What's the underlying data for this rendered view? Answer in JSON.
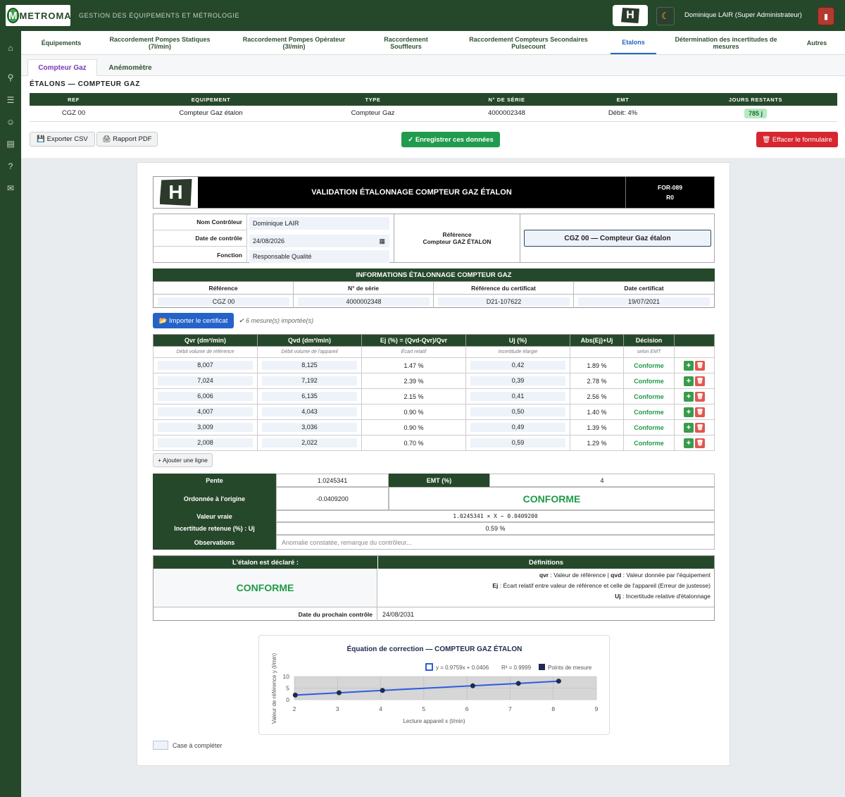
{
  "topbar": {
    "logo_letter": "M",
    "logo_word": "METROMAT",
    "subtitle": "GESTION DES ÉQUIPEMENTS ET MÉTROLOGIE",
    "user": "Dominique LAIR (Super Administrateur)",
    "logo_h": "H",
    "theme_icon": "moon-icon",
    "logout_icon": "logout-icon"
  },
  "sidebar": {
    "icons": [
      "home-icon",
      "search-icon",
      "sliders-icon",
      "user-icon",
      "document-icon",
      "help-icon",
      "mail-icon"
    ]
  },
  "nav": {
    "tabs": [
      {
        "label": "Équipements"
      },
      {
        "label": "Raccordement Pompes Statiques (7l/min)"
      },
      {
        "label": "Raccordement Pompes Opérateur (3l/min)"
      },
      {
        "label": "Raccordement Souffleurs"
      },
      {
        "label": "Raccordement Compteurs Secondaires Pulsecount"
      },
      {
        "label": "Etalons"
      },
      {
        "label": "Détermination des incertitudes de mesures"
      },
      {
        "label": "Autres"
      }
    ],
    "active": "Etalons"
  },
  "subtabs": [
    {
      "label": "Compteur Gaz"
    },
    {
      "label": "Anémomètre"
    }
  ],
  "etalons": {
    "title": "ÉTALONS — COMPTEUR GAZ",
    "headers": [
      "REF",
      "EQUIPEMENT",
      "TYPE",
      "N° DE SÉRIE",
      "EMT",
      "JOURS RESTANTS"
    ],
    "row": {
      "ref": "CGZ 00",
      "equipement": "Compteur Gaz étalon",
      "type": "Compteur Gaz",
      "serie": "4000002348",
      "emt": "Débit: 4%",
      "jours": "785 j"
    }
  },
  "actions": {
    "csv": "💾 Exporter CSV",
    "pdf": "🖨 Rapport PDF",
    "save": "✓ Enregistrer ces données",
    "clear": "🗑 Effacer le formulaire"
  },
  "form": {
    "header": {
      "logo": "H",
      "title": "VALIDATION ÉTALONNAGE COMPTEUR GAZ ÉTALON",
      "code": "FOR-089",
      "rev": "R0"
    },
    "controller": {
      "name_label": "Nom Contrôleur",
      "name": "Dominique LAIR",
      "date_label": "Date de contrôle",
      "date": "24/08/2026",
      "fn_label": "Fonction",
      "fn": "Responsable Qualité",
      "ref_label_1": "Référence",
      "ref_label_2": "Compteur GAZ ÉTALON",
      "ref_value": "CGZ 00 — Compteur Gaz étalon"
    },
    "info": {
      "title": "INFORMATIONS ÉTALONNAGE COMPTEUR GAZ",
      "headers": [
        "Référence",
        "N° de série",
        "Référence du certificat",
        "Date certificat"
      ],
      "values": [
        "CGZ 00",
        "4000002348",
        "D21-107622",
        "19/07/2021"
      ]
    },
    "import": {
      "button": "📂 Importer le certificat",
      "status": "✔ 6 mesure(s) importée(s)"
    },
    "measures": {
      "headers": [
        "Qvr (dm³/min)",
        "Qvd (dm³/min)",
        "Ej (%) = (Qvd-Qvr)/Qvr",
        "Uj (%)",
        "Abs(Ej)+Uj",
        "Décision"
      ],
      "subheaders": [
        "Débit volume de référence",
        "Débit volume de l'appareil",
        "Écart relatif",
        "Incertitude élargie",
        "",
        "selon EMT"
      ],
      "rows": [
        {
          "qvr": "8,007",
          "qvd": "8,125",
          "ej": "1.47 %",
          "uj": "0,42",
          "abs": "1.89 %",
          "dec": "Conforme"
        },
        {
          "qvr": "7,024",
          "qvd": "7,192",
          "ej": "2.39 %",
          "uj": "0,39",
          "abs": "2.78 %",
          "dec": "Conforme"
        },
        {
          "qvr": "6,006",
          "qvd": "6,135",
          "ej": "2.15 %",
          "uj": "0,41",
          "abs": "2.56 %",
          "dec": "Conforme"
        },
        {
          "qvr": "4,007",
          "qvd": "4,043",
          "ej": "0.90 %",
          "uj": "0,50",
          "abs": "1.40 %",
          "dec": "Conforme"
        },
        {
          "qvr": "3,009",
          "qvd": "3,036",
          "ej": "0.90 %",
          "uj": "0,49",
          "abs": "1.39 %",
          "dec": "Conforme"
        },
        {
          "qvr": "2,008",
          "qvd": "2,022",
          "ej": "0.70 %",
          "uj": "0,59",
          "abs": "1.29 %",
          "dec": "Conforme"
        }
      ],
      "add_row": "+ Ajouter une ligne",
      "plus": "+",
      "del": "🗑"
    },
    "calc": {
      "pente_l": "Pente",
      "pente": "1.0245341",
      "emt_l": "EMT (%)",
      "emt": "4",
      "ord_l": "Ordonnée à l'origine",
      "ord": "-0.0409200",
      "verdict": "CONFORME",
      "vv_l": "Valeur vraie",
      "vv": "1.0245341 × X − 0.0409200",
      "inc_l": "Incertitude retenue (%) : Uj",
      "inc": "0.59 %",
      "obs_l": "Observations",
      "obs_ph": "Anomalie constatée, remarque du contrôleur..."
    },
    "decl": {
      "title": "L'étalon est déclaré :",
      "verdict": "CONFORME",
      "def_title": "Définitions",
      "d1a": "qvr",
      "d1b": " : Valeur de référence  |  ",
      "d1c": "qvd",
      "d1d": " : Valeur donnée par l'équipement",
      "d2a": "Ej",
      "d2b": " : Écart relatif entre valeur de référence et celle de l'appareil (Erreur de justesse)",
      "d3a": "Uj",
      "d3b": " : Incertitude relative d'étalonnage",
      "next_l": "Date du prochain contrôle",
      "next": "24/08/2031"
    },
    "legend_text": "Case à compléter"
  },
  "chart_data": {
    "type": "line",
    "title": "Équation de correction — COMPTEUR GAZ ÉTALON",
    "xlabel": "Lecture appareil x (l/min)",
    "ylabel": "Valeur de référence y (l/min)",
    "xlim": [
      2,
      9
    ],
    "ylim": [
      0,
      10
    ],
    "xticks": [
      2,
      3,
      4,
      5,
      6,
      7,
      8,
      9
    ],
    "yticks": [
      0,
      5,
      10
    ],
    "series": [
      {
        "name": "y = 0.9759x + 0.0406",
        "x": [
          2,
          9
        ],
        "y": [
          1.99,
          8.82
        ]
      },
      {
        "name": "Points de mesure",
        "x": [
          2.022,
          3.036,
          4.043,
          6.135,
          7.192,
          8.125
        ],
        "y": [
          2.008,
          3.009,
          4.007,
          6.006,
          7.024,
          8.007
        ]
      }
    ],
    "r2": "R² = 0.9999",
    "colors": {
      "line": "#2d5ce0",
      "points": "#1f2a4e"
    }
  }
}
